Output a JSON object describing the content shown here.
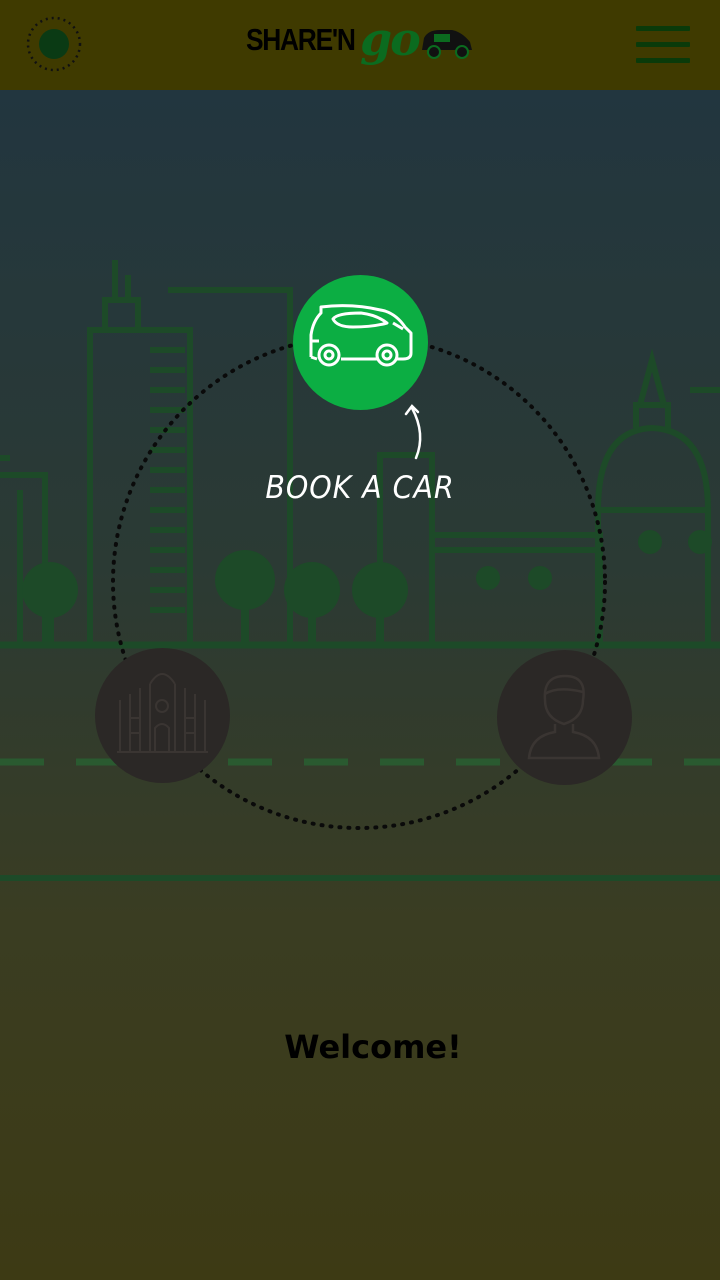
{
  "header": {
    "logo_text": "SHARE'N",
    "logo_go": "go",
    "menu_icon": "hamburger-menu-icon",
    "status_icon": "status-dot-icon"
  },
  "main": {
    "book_label": "BOOK A CAR",
    "book_icon": "car-icon",
    "duomo_icon": "cathedral-icon",
    "profile_icon": "user-icon",
    "welcome": "Welcome!"
  },
  "colors": {
    "accent_green": "#0cae43",
    "topbar": "#3f3a00",
    "disabled_button": "#2b2826"
  }
}
